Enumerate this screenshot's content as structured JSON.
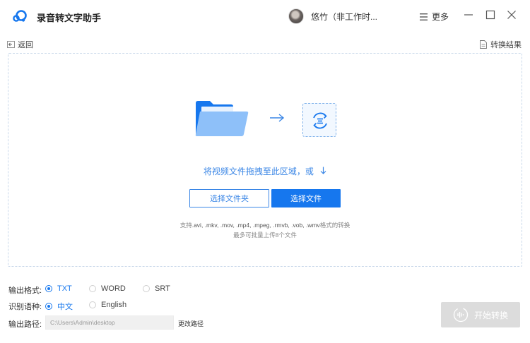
{
  "app": {
    "title": "录音转文字助手"
  },
  "user": {
    "name": "悠竹（非工作时..."
  },
  "header": {
    "more_label": "更多"
  },
  "nav": {
    "back_label": "返回",
    "result_label": "转换结果"
  },
  "dropzone": {
    "prompt": "将视频文件拖拽至此区域，或",
    "select_folder_label": "选择文件夹",
    "select_file_label": "选择文件",
    "support_prefix": "支持",
    "support_formats": ".avi, .mkv, .mov, .mp4, .mpeg, .rmvb, .vob, .wmv",
    "support_suffix": "格式的转换",
    "limit_text": "最多可批量上传8个文件"
  },
  "options": {
    "format_label": "输出格式:",
    "formats": [
      {
        "label": "TXT",
        "selected": true
      },
      {
        "label": "WORD",
        "selected": false
      },
      {
        "label": "SRT",
        "selected": false
      }
    ],
    "language_label": "识别语种:",
    "languages": [
      {
        "label": "中文",
        "selected": true
      },
      {
        "label": "English",
        "selected": false
      }
    ],
    "path_label": "输出路径:",
    "path_value": "C:\\Users\\Admin\\desktop",
    "change_path_label": "更改路径"
  },
  "start": {
    "label": "开始转换",
    "enabled": false
  },
  "colors": {
    "accent": "#1677ee",
    "disabled": "#dcdcdc"
  }
}
